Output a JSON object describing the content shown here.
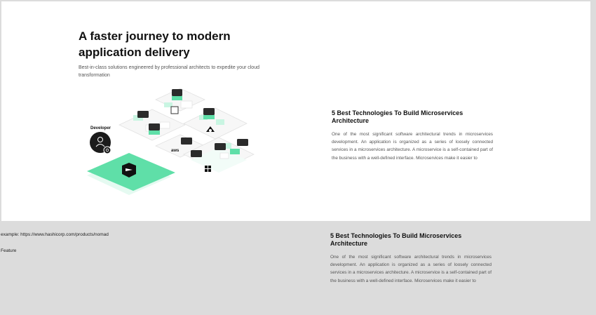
{
  "hero": {
    "title": "A faster journey to modern application delivery",
    "subtitle": "Best-in-class solutions engineered by professional architects to expedite your cloud transformation",
    "illustration": {
      "developer_label": "Developer",
      "logo_label": "aws",
      "icons": [
        "user-icon",
        "gear-icon",
        "nomad-logo-icon",
        "aws-logo-icon",
        "windows-logo-icon",
        "chip-icon"
      ]
    }
  },
  "articles": [
    {
      "title": "5 Best Technologies To Build Microservices Architecture",
      "body": "One of the most significant software architectural trends in microservices development. An application is organized as a series of loosely connected services in a microservices architecture. A microservice is a self-contained part of the business with a well-defined interface. Microservices make it easier to"
    },
    {
      "title": "5 Best Technologies To Build Microservices Architecture",
      "body": "One of the most significant software architectural trends in microservices development. An application is organized as a series of loosely connected services in a microservices architecture. A microservice is a self-contained part of the business with a well-defined interface. Microservices make it easier to"
    }
  ],
  "notes": {
    "example": "example: https://www.hashicorp.com/products/nomad",
    "feature": "Feature"
  },
  "colors": {
    "accent_green": "#5fdfa8",
    "pale_green": "#c9f5e2",
    "chip_dark": "#2b2b2b",
    "background": "#dcdcdc"
  }
}
